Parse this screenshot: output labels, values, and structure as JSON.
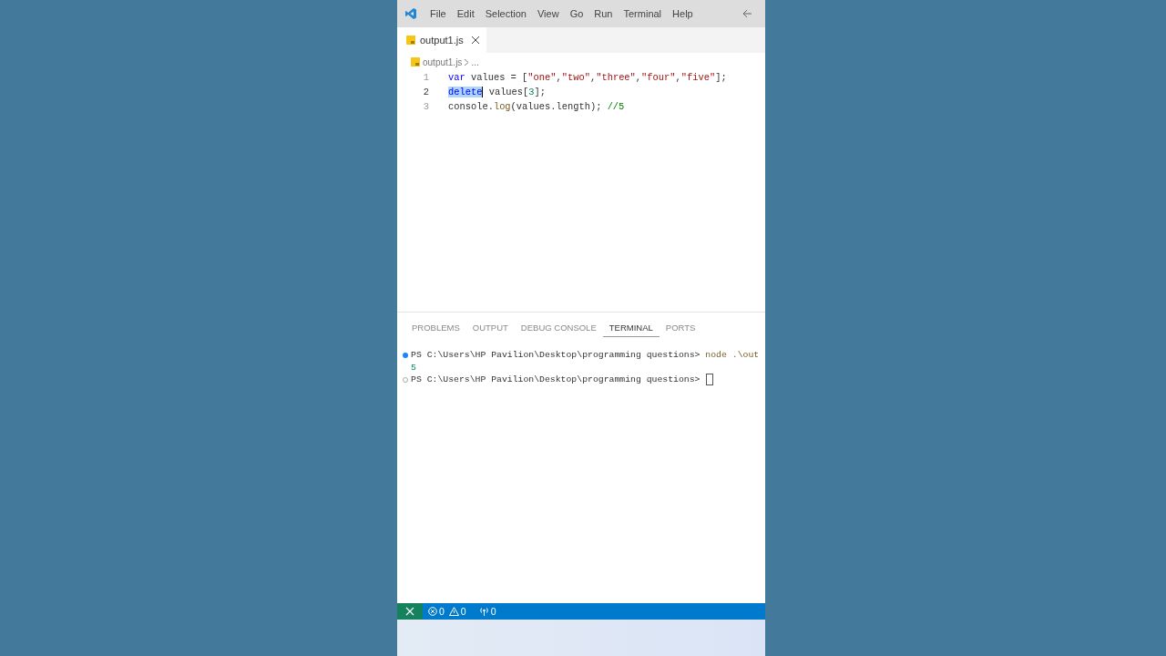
{
  "menu": [
    "File",
    "Edit",
    "Selection",
    "View",
    "Go",
    "Run",
    "Terminal",
    "Help"
  ],
  "tabs": [
    {
      "label": "output1.js",
      "selected": true
    }
  ],
  "breadcrumb": {
    "file": "output1.js",
    "rest": "..."
  },
  "code": [
    {
      "number": "1",
      "tokens": [
        {
          "kind": "keyword",
          "text": "var"
        },
        {
          "kind": "plain",
          "text": " values = ["
        },
        {
          "kind": "string",
          "text": "\"one\""
        },
        {
          "kind": "plain",
          "text": ","
        },
        {
          "kind": "string",
          "text": "\"two\""
        },
        {
          "kind": "plain",
          "text": ","
        },
        {
          "kind": "string",
          "text": "\"three\""
        },
        {
          "kind": "plain",
          "text": ","
        },
        {
          "kind": "string",
          "text": "\"four\""
        },
        {
          "kind": "plain",
          "text": ","
        },
        {
          "kind": "string",
          "text": "\"five\""
        },
        {
          "kind": "plain",
          "text": "];"
        }
      ]
    },
    {
      "number": "2",
      "tokens": [
        {
          "kind": "selection",
          "text": "delete"
        },
        {
          "kind": "plain",
          "text": " values["
        },
        {
          "kind": "number",
          "text": "3"
        },
        {
          "kind": "plain",
          "text": "];"
        }
      ]
    },
    {
      "number": "3",
      "tokens": [
        {
          "kind": "plain",
          "text": "console."
        },
        {
          "kind": "function",
          "text": "log"
        },
        {
          "kind": "plain",
          "text": "(values.length); "
        },
        {
          "kind": "comment",
          "text": "//5"
        }
      ]
    }
  ],
  "panel_tabs": [
    {
      "label": "PROBLEMS",
      "selected": false
    },
    {
      "label": "OUTPUT",
      "selected": false
    },
    {
      "label": "DEBUG CONSOLE",
      "selected": false
    },
    {
      "label": "TERMINAL",
      "selected": true
    },
    {
      "label": "PORTS",
      "selected": false
    }
  ],
  "terminal": [
    {
      "kind": "prompt",
      "finished": true,
      "text": "PS C:\\Users\\HP Pavilion\\Desktop\\programming questions> ",
      "command": "node .\\out"
    },
    {
      "kind": "output",
      "text": "5"
    },
    {
      "kind": "prompt",
      "finished": false,
      "text": "PS C:\\Users\\HP Pavilion\\Desktop\\programming questions> ",
      "cursor": true
    }
  ],
  "status_bar": {
    "errors": "0",
    "warnings": "0",
    "ports": "0"
  }
}
